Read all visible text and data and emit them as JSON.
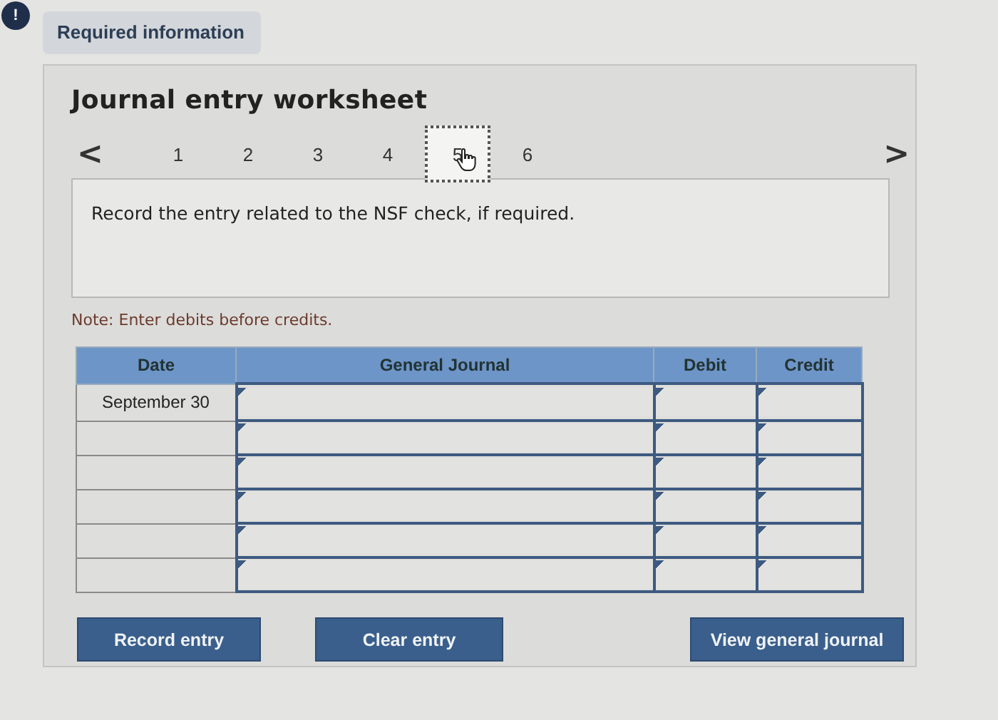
{
  "alert_badge": "!",
  "required_tab": {
    "label": "Required information",
    "selected": true
  },
  "worksheet": {
    "title": "Journal entry worksheet",
    "pager": {
      "prev": "<",
      "next": ">",
      "pages": [
        {
          "label": "1",
          "selected": false
        },
        {
          "label": "2",
          "selected": false
        },
        {
          "label": "3",
          "selected": false
        },
        {
          "label": "4",
          "selected": false
        },
        {
          "label": "5",
          "selected": true
        },
        {
          "label": "6",
          "selected": false
        }
      ]
    },
    "instruction": "Record the entry related to the NSF check, if required.",
    "note": "Note: Enter debits before credits.",
    "table": {
      "columns": [
        "Date",
        "General Journal",
        "Debit",
        "Credit"
      ],
      "rows": [
        {
          "date": "September 30"
        },
        {},
        {},
        {},
        {},
        {}
      ]
    },
    "buttons": [
      "Record entry",
      "Clear entry",
      "View general journal"
    ]
  }
}
